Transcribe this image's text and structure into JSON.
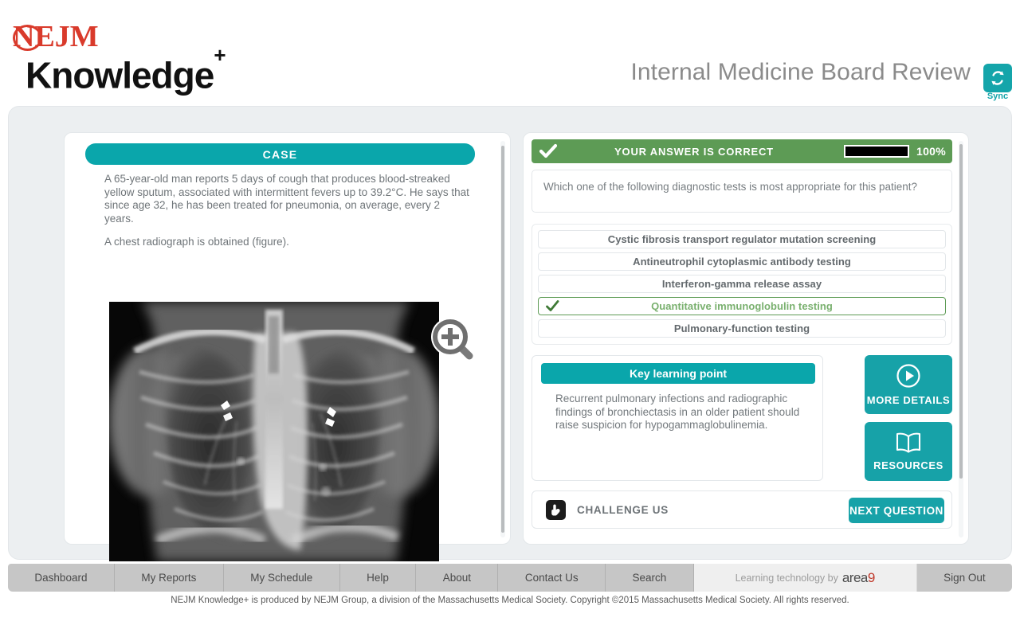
{
  "header": {
    "logo_primary": "NEJM",
    "logo_secondary": "Knowledge",
    "logo_plus": "+",
    "title": "Internal Medicine Board Review",
    "sync_label": "Sync",
    "sync_icon": "sync-refresh-icon"
  },
  "case": {
    "header_label": "CASE",
    "paragraphs": [
      "A 65-year-old man reports 5 days of cough that produces blood-streaked yellow sputum, associated with intermittent fevers up to 39.2°C. He says that since age 32, he has been treated for pneumonia, on average, every 2 years.",
      "A chest radiograph is obtained (figure)."
    ],
    "figure_alt": "chest-radiograph",
    "zoom_icon": "magnifier-plus-icon"
  },
  "answer": {
    "status_text": "YOUR ANSWER IS CORRECT",
    "status_icon": "checkmark-icon",
    "score_percent": "100%",
    "score_value": 100,
    "question": "Which one of the following diagnostic tests is most appropriate for this patient?",
    "choices": [
      {
        "label": "Cystic fibrosis transport regulator mutation screening",
        "correct": false
      },
      {
        "label": "Antineutrophil cytoplasmic antibody testing",
        "correct": false
      },
      {
        "label": "Interferon-gamma release assay",
        "correct": false
      },
      {
        "label": "Quantitative immunoglobulin testing",
        "correct": true
      },
      {
        "label": "Pulmonary-function testing",
        "correct": false
      }
    ]
  },
  "key_learning_point": {
    "header_label": "Key learning point",
    "text": "Recurrent pulmonary infections and radiographic findings of bronchiectasis in an older patient should raise suspicion for hypogammaglobulinemia."
  },
  "side_buttons": [
    {
      "label": "MORE DETAILS",
      "icon": "play-circle-icon"
    },
    {
      "label": "RESOURCES",
      "icon": "open-book-icon"
    }
  ],
  "challenge": {
    "label": "CHALLENGE US",
    "icon": "pointing-hand-icon",
    "next_button": "NEXT QUESTION"
  },
  "footer": {
    "nav_items": [
      "Dashboard",
      "My Reports",
      "My Schedule",
      "Help",
      "About",
      "Contact Us",
      "Search"
    ],
    "brand_prefix": "Learning technology by",
    "brand_name": "area",
    "brand_suffix": "9",
    "sign_out": "Sign Out",
    "copyright": "NEJM Knowledge+ is produced by NEJM Group, a division of the Massachusetts Medical Society. Copyright ©2015 Massachusetts Medical Society. All rights reserved."
  },
  "colors": {
    "teal": "#0aa6ab",
    "green": "#5d9b55",
    "brand_red": "#d93a2b",
    "shell_bg": "#eceff1"
  }
}
